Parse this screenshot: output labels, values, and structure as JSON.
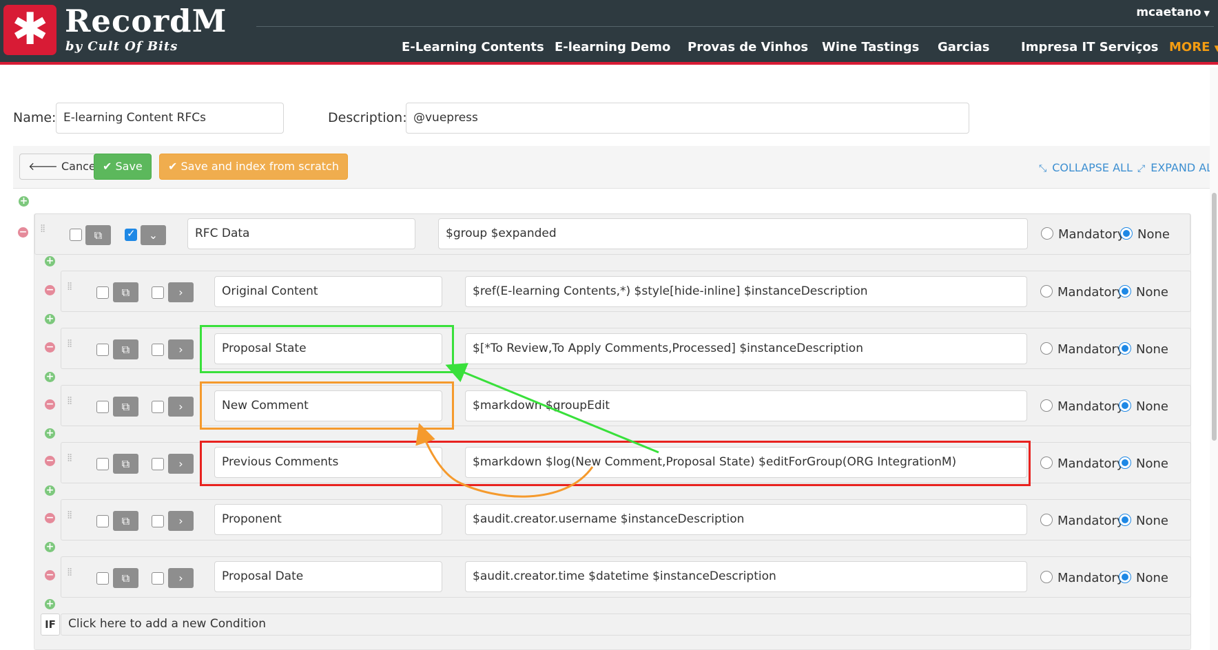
{
  "header": {
    "logo_glyph": "✱",
    "app_name": "RecordM",
    "tagline": "by Cult Of Bits",
    "user": "mcaetano",
    "nav": [
      "E-Learning Contents",
      "E-learning Demo",
      "Provas de Vinhos",
      "Wine Tastings",
      "Garcias",
      "Impresa IT Serviços"
    ],
    "more": "MORE"
  },
  "form": {
    "name_label": "Name:",
    "name_value": "E-learning Content RFCs",
    "description_label": "Description:",
    "description_value": "@vuepress"
  },
  "toolbar": {
    "cancel": "Cancel",
    "save": "Save",
    "save_index": "Save and index from scratch",
    "collapse_all": "COLLAPSE ALL",
    "expand_all": "EXPAND ALL"
  },
  "fields": [
    {
      "name": "RFC Data",
      "description": "$group $expanded",
      "duplicate_checked": false,
      "expand_checked": true,
      "mandatory": false
    },
    {
      "name": "Original Content",
      "description": "$ref(E-learning Contents,*) $style[hide-inline]  $instanceDescription",
      "duplicate_checked": false,
      "expand_checked": false,
      "mandatory": false
    },
    {
      "name": "Proposal State",
      "description": "$[*To Review,To Apply Comments,Processed] $instanceDescription",
      "duplicate_checked": false,
      "expand_checked": false,
      "mandatory": false
    },
    {
      "name": "New Comment",
      "description": "$markdown $groupEdit",
      "duplicate_checked": false,
      "expand_checked": false,
      "mandatory": false
    },
    {
      "name": "Previous Comments",
      "description": "$markdown $log(New Comment,Proposal State) $editForGroup(ORG IntegrationM)",
      "duplicate_checked": false,
      "expand_checked": false,
      "mandatory": false
    },
    {
      "name": "Proponent",
      "description": "$audit.creator.username $instanceDescription",
      "duplicate_checked": false,
      "expand_checked": false,
      "mandatory": false
    },
    {
      "name": "Proposal Date",
      "description": "$audit.creator.time $datetime $instanceDescription",
      "duplicate_checked": false,
      "expand_checked": false,
      "mandatory": false
    }
  ],
  "radio_labels": {
    "mandatory": "Mandatory",
    "none": "None"
  },
  "condition": {
    "if_label": "IF",
    "text": "Click here to add a new Condition"
  },
  "annotations": {
    "green": "#39e03b",
    "orange": "#f59a2d",
    "red": "#e8221f"
  }
}
